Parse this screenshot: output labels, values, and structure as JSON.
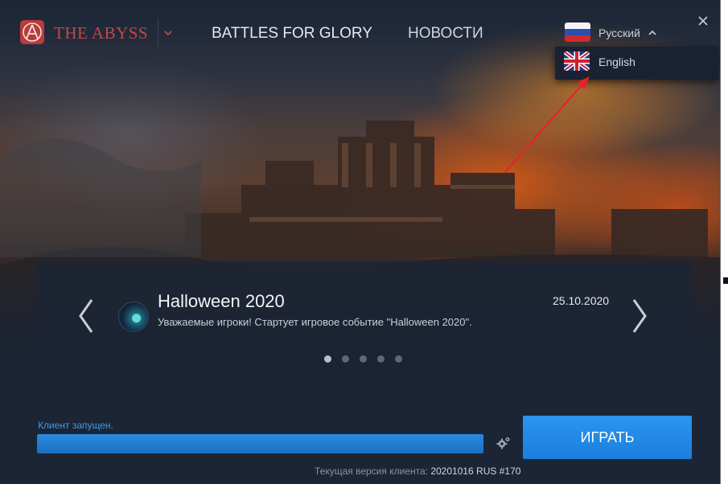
{
  "header": {
    "brand": "THE ABYSS",
    "nav": {
      "battles": "BATTLES FOR GLORY",
      "news": "НОВОСТИ"
    },
    "language": {
      "current": "Русский",
      "option": "English"
    }
  },
  "news": {
    "title": "Halloween 2020",
    "text": "Уважаемые игроки! Стартует игровое событие \"Halloween 2020\".",
    "date": "25.10.2020",
    "dots_total": 5,
    "active_dot": 1
  },
  "footer": {
    "status": "Клиент запущен.",
    "progress": 1.0,
    "play_label": "ИГРАТЬ",
    "version_label": "Текущая версия клиента:",
    "version_value": "20201016 RUS #170"
  },
  "colors": {
    "accent": "#2b95ee",
    "brand": "#c04848",
    "background": "#1b2535",
    "annotation_arrow": "#e8202a"
  },
  "icons": [
    "logo-icon",
    "chevron-down-icon",
    "flag-russia-icon",
    "chevron-up-icon",
    "close-icon",
    "flag-uk-icon",
    "chevron-left-icon",
    "chevron-right-icon",
    "gear-icon"
  ]
}
